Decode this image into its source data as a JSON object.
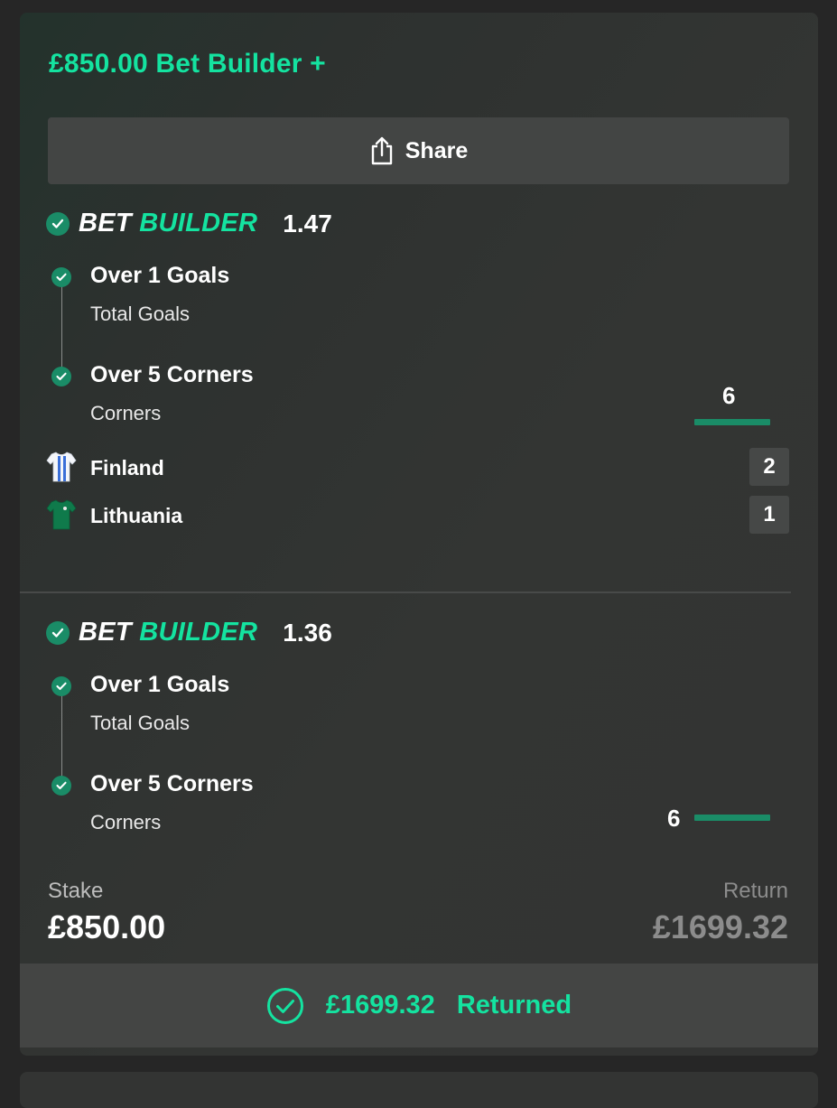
{
  "header": {
    "title": "£850.00 Bet Builder +"
  },
  "share": {
    "label": "Share",
    "icon": "share-icon"
  },
  "bet_builders": [
    {
      "logo_white": "BET",
      "logo_green": "BUILDER",
      "odds": "1.47",
      "legs": [
        {
          "title": "Over 1 Goals",
          "subtitle": "Total Goals"
        },
        {
          "title": "Over 5 Corners",
          "subtitle": "Corners",
          "stat": "6"
        }
      ],
      "teams": [
        {
          "name": "Finland",
          "score": "2",
          "icon": "finland-shirt-icon"
        },
        {
          "name": "Lithuania",
          "score": "1",
          "icon": "lithuania-shirt-icon"
        }
      ]
    },
    {
      "logo_white": "BET",
      "logo_green": "BUILDER",
      "odds": "1.36",
      "legs": [
        {
          "title": "Over 1 Goals",
          "subtitle": "Total Goals"
        },
        {
          "title": "Over 5 Corners",
          "subtitle": "Corners",
          "stat": "6"
        }
      ]
    }
  ],
  "summary": {
    "stake_label": "Stake",
    "stake": "£850.00",
    "return_label": "Return",
    "return": "£1699.32"
  },
  "result": {
    "amount": "£1699.32",
    "status": "Returned",
    "icon": "check-circle-icon"
  },
  "colors": {
    "accent": "#14e3a0",
    "check_green": "#1a8c67",
    "card_bg": "#333433",
    "page_bg": "#262626"
  }
}
